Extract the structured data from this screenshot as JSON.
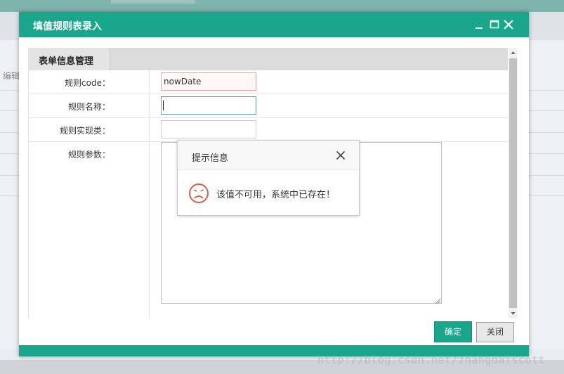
{
  "background": {
    "edit_label": "编辑"
  },
  "dialog": {
    "title": "填值规则表录入",
    "tab_label": "表单信息管理",
    "fields": [
      {
        "label": "规则code：",
        "value": "nowDate"
      },
      {
        "label": "规则名称：",
        "value": ""
      },
      {
        "label": "规则实现类：",
        "value": ""
      },
      {
        "label": "规则参数：",
        "value": ""
      }
    ],
    "ok_label": "确定",
    "close_label": "关闭"
  },
  "message": {
    "title": "提示信息",
    "text": "该值不可用，系统中已存在！"
  },
  "watermark": "http://blog.csdn.net/zhangdaiscott",
  "colors": {
    "accent": "#1aa68a",
    "error_icon": "#e05a4a"
  }
}
